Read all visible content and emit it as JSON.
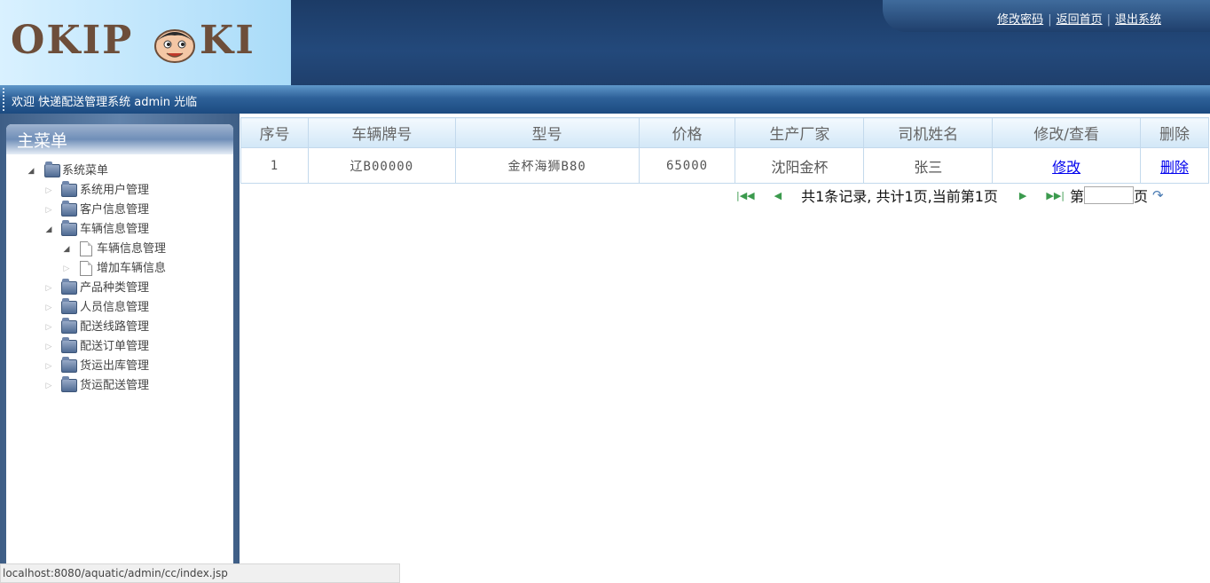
{
  "logo": {
    "text_left": "OKIP",
    "text_right": "KI"
  },
  "top_links": [
    "修改密码",
    "返回首页",
    "退出系统"
  ],
  "welcome": "欢迎 快递配送管理系统 admin 光临",
  "menu": {
    "title": "主菜单",
    "root": "系统菜单",
    "items": [
      {
        "label": "系统用户管理"
      },
      {
        "label": "客户信息管理"
      },
      {
        "label": "车辆信息管理",
        "children": [
          "车辆信息管理",
          "增加车辆信息"
        ]
      },
      {
        "label": "产品种类管理"
      },
      {
        "label": "人员信息管理"
      },
      {
        "label": "配送线路管理"
      },
      {
        "label": "配送订单管理"
      },
      {
        "label": "货运出库管理"
      },
      {
        "label": "货运配送管理"
      }
    ]
  },
  "table": {
    "headers": [
      "序号",
      "车辆牌号",
      "型号",
      "价格",
      "生产厂家",
      "司机姓名",
      "修改/查看",
      "删除"
    ],
    "rows": [
      {
        "index": "1",
        "plate": "辽B00000",
        "model": "金杯海狮B80",
        "price": "65000",
        "maker": "沈阳金杯",
        "driver": "张三",
        "edit": "修改",
        "delete": "删除"
      }
    ]
  },
  "pager": {
    "summary": "共1条记录, 共计1页,当前第1页",
    "prefix": "第",
    "suffix": "页",
    "input_value": ""
  },
  "status_bar": "localhost:8080/aquatic/admin/cc/index.jsp",
  "colors": {
    "header_bg": "#23497b",
    "welcome_bg": "#2e6199",
    "link": "#0000ee",
    "pager_icon": "#3b9a4d"
  }
}
